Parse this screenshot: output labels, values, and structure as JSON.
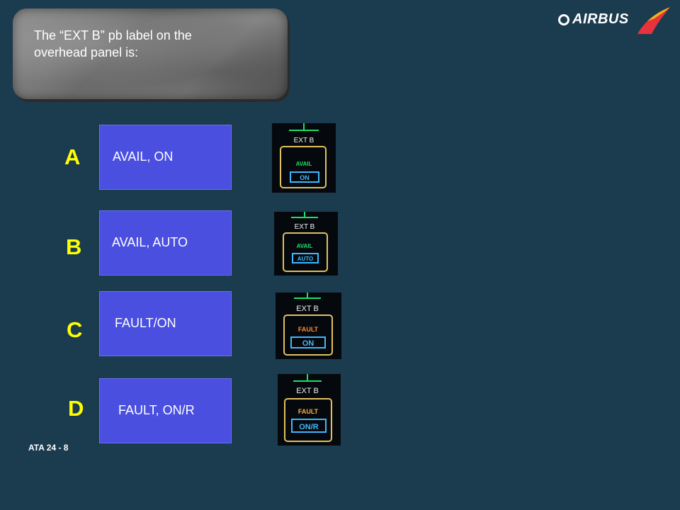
{
  "question": {
    "line1": "The “EXT B” pb label on the",
    "line2": "overhead panel is:"
  },
  "logo": {
    "text": "AIRBUS"
  },
  "options": [
    {
      "letter": "A",
      "label": "AVAIL, ON",
      "panel": {
        "title": "EXT B",
        "upper": "AVAIL",
        "lower": "ON",
        "upper_color": "#19e06a"
      }
    },
    {
      "letter": "B",
      "label": "AVAIL, AUTO",
      "panel": {
        "title": "EXT B",
        "upper": "AVAIL",
        "lower": "AUTO",
        "upper_color": "#19e06a"
      }
    },
    {
      "letter": "C",
      "label": "FAULT/ON",
      "panel": {
        "title": "EXT B",
        "upper": "FAULT",
        "lower": "ON",
        "upper_color": "#ff8a2a"
      }
    },
    {
      "letter": "D",
      "label": "FAULT,  ON/R",
      "panel": {
        "title": "EXT B",
        "upper": "FAULT",
        "lower": "ON/R",
        "upper_color": "#ffb040"
      }
    }
  ],
  "footer": {
    "text": "ATA 24 - 8"
  },
  "colors": {
    "background": "#1b3b4e",
    "button": "#4a4fe0",
    "letter": "#ffff00",
    "panel_frame": "#e0c060",
    "panel_lower": "#3fb8ff"
  }
}
